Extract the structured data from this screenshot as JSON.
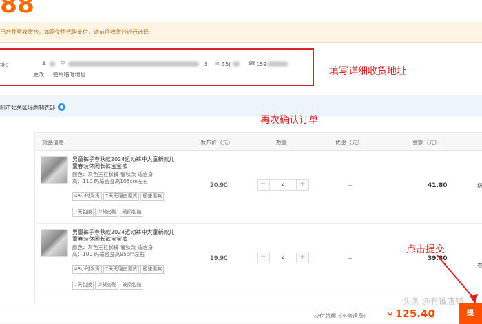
{
  "header": {
    "logo_fragment": "88"
  },
  "notice": {
    "text": "已合并至收货合，如需使用代购支付，请前往收货合进行选择"
  },
  "address": {
    "label": "址：",
    "city_fragment": "5",
    "district_fragment": "35(",
    "phone_fragment": "159",
    "edit_link": "更改",
    "temp_link": "使用临时地址"
  },
  "annotations": {
    "fill_address": "填写详细收货地址",
    "confirm_order": "再次确认订单",
    "click_submit": "点击提交"
  },
  "shop": {
    "name": "阳市北关区瑶颜制衣部"
  },
  "table": {
    "headers": {
      "goods": "货品信息",
      "price": "发布价（元）",
      "qty": "数量",
      "promo": "优惠（元）",
      "amount": "金额（元）"
    },
    "rows": [
      {
        "title": "男童裤子春秋款2024运动裤中大童新款儿童春装休闲长裤宝宝裤",
        "attr1": "颜色：灰色三杠长裤 春秋款  适合身",
        "attr2": "高：110 码适合身高105cm左右",
        "tags": [
          "48小时发货",
          "7天无理由退货",
          "极速退款",
          "7天包换",
          "少货必赔",
          "破损包赔"
        ],
        "price": "20.90",
        "qty": "2",
        "promo": "--",
        "amount": "41.80"
      },
      {
        "title": "男童裤子春秋款2024运动裤中大童新款儿童春装休闲长裤宝宝裤",
        "attr1": "颜色：灰色三杠长裤 春秋款  适合身",
        "attr2": "高：100 码适合身高95cm左右",
        "tags": [
          "48小时发货",
          "7天无理由退货",
          "极速退款",
          "7天包换",
          "少货必赔",
          "破损包赔"
        ],
        "price": "19.90",
        "qty": "2",
        "promo": "--",
        "amount": "39.80"
      }
    ],
    "side_cut": [
      "极",
      "查"
    ]
  },
  "footer": {
    "total_label": "应付总额（不含运费）",
    "currency": "¥",
    "total": "125.40",
    "unit": "元",
    "submit_label": "提"
  },
  "watermark": "头条 @有谁店铺"
}
